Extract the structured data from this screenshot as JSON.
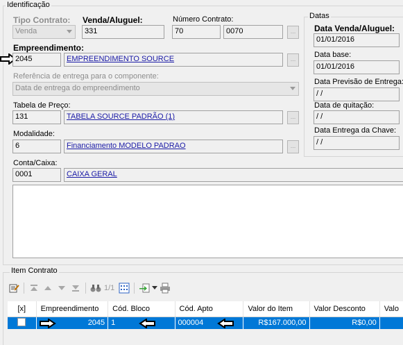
{
  "identificacao": {
    "title": "Identificação",
    "tipo_contrato": {
      "label": "Tipo Contrato:",
      "value": "Venda"
    },
    "venda_aluguel": {
      "label": "Venda/Aluguel:",
      "value": "331"
    },
    "numero_contrato": {
      "label": "Número Contrato:",
      "value1": "70",
      "value2": "0070",
      "btn": "..."
    },
    "empreendimento": {
      "label": "Empreendimento:",
      "code": "2045",
      "name": "EMPREENDIMENTO SOURCE",
      "btn": "..."
    },
    "referencia": {
      "label": "Referência de entrega para o componente:",
      "value": "Data de entrega do empreendimento"
    },
    "tabela_preco": {
      "label": "Tabela de Preço:",
      "code": "131",
      "name": "TABELA SOURCE PADRÃO (1)",
      "btn": "..."
    },
    "modalidade": {
      "label": "Modalidade:",
      "code": "6",
      "name": "Financiamento MODELO PADRAO",
      "btn": "..."
    },
    "conta_caixa": {
      "label": "Conta/Caixa:",
      "code": "0001",
      "name": "CAIXA GERAL"
    }
  },
  "datas": {
    "title": "Datas",
    "venda_aluguel": {
      "label": "Data Venda/Aluguel:",
      "value": "01/01/2016"
    },
    "base": {
      "label": "Data base:",
      "value": "01/01/2016"
    },
    "previsao_entrega": {
      "label": "Data Previsão de Entrega:",
      "value": " / /"
    },
    "quitacao": {
      "label": "Data de quitação:",
      "value": " / /"
    },
    "entrega_chave": {
      "label": "Data Entrega da Chave:",
      "value": " / /"
    }
  },
  "item_contrato": {
    "title": "Item Contrato",
    "pager": "1/1",
    "columns": [
      "[x]",
      "Empreendimento",
      "Cód. Bloco",
      "Cód. Apto",
      "Valor do Item",
      "Valor Desconto",
      "Valo"
    ],
    "row": {
      "empreendimento": "2045",
      "bloco": "1",
      "apto": "000004",
      "valor_item": "R$167.000,00",
      "valor_desconto": "R$0,00"
    }
  },
  "colors": {
    "selection": "#0078d7",
    "link": "#1a1aa6"
  }
}
